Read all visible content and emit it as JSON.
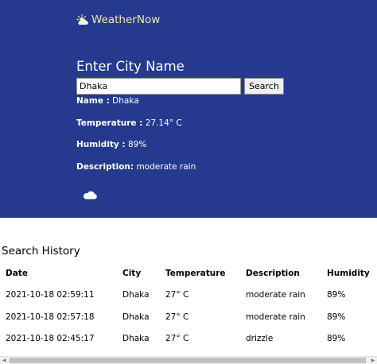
{
  "brand": {
    "name": "WeatherNow",
    "icon": "cloud-sun-icon",
    "color": "#f5e9a6"
  },
  "colors": {
    "hero_bg": "#25398e"
  },
  "search": {
    "title": "Enter City Name",
    "input_value": "Dhaka",
    "button_label": "Search"
  },
  "result": {
    "name_label": "Name :",
    "name_value": "Dhaka",
    "temperature_label": "Temperature :",
    "temperature_value": "27.14° C",
    "humidity_label": "Humidity :",
    "humidity_value": "89%",
    "description_label": "Description:",
    "description_value": "moderate rain",
    "icon": "cloud-icon"
  },
  "history": {
    "title": "Search History",
    "columns": [
      "Date",
      "City",
      "Temperature",
      "Description",
      "Humidity"
    ],
    "rows": [
      [
        "2021-10-18 02:59:11",
        "Dhaka",
        "27° C",
        "moderate rain",
        "89%"
      ],
      [
        "2021-10-18 02:57:18",
        "Dhaka",
        "27° C",
        "moderate rain",
        "89%"
      ],
      [
        "2021-10-18 02:45:17",
        "Dhaka",
        "27° C",
        "drizzle",
        "89%"
      ]
    ]
  }
}
